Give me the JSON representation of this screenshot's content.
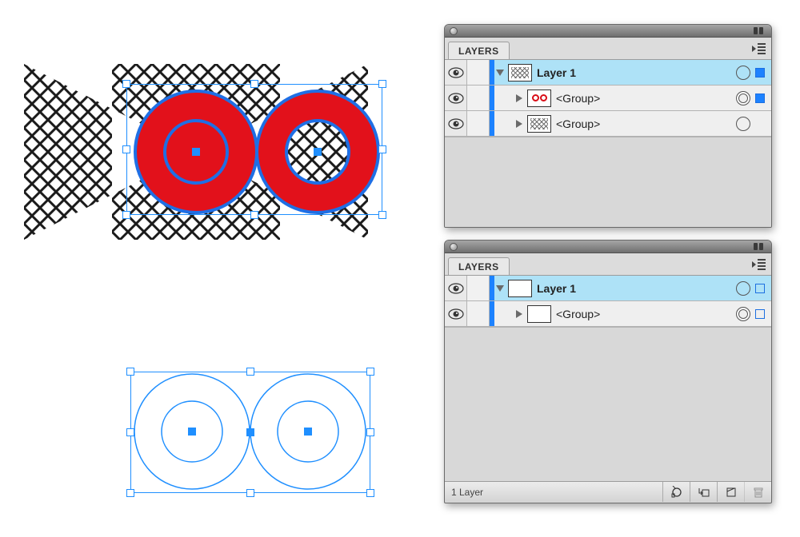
{
  "panel1": {
    "tab": "LAYERS",
    "rows": [
      {
        "name": "Layer 1",
        "bold": true,
        "selected": true,
        "thumb": "hatch",
        "expand": "down",
        "target": "single",
        "selSquare": "filled",
        "indent": 0
      },
      {
        "name": "<Group>",
        "bold": false,
        "selected": false,
        "thumb": "oo",
        "expand": "right",
        "target": "double",
        "selSquare": "filled",
        "indent": 1
      },
      {
        "name": "<Group>",
        "bold": false,
        "selected": false,
        "thumb": "hatch",
        "expand": "right",
        "target": "single",
        "selSquare": "none",
        "indent": 1
      }
    ]
  },
  "panel2": {
    "tab": "LAYERS",
    "status": "1 Layer",
    "rows": [
      {
        "name": "Layer 1",
        "bold": true,
        "selected": true,
        "thumb": "blank",
        "expand": "down",
        "target": "single",
        "selSquare": "outline",
        "indent": 0
      },
      {
        "name": "<Group>",
        "bold": false,
        "selected": false,
        "thumb": "blank",
        "expand": "right",
        "target": "double",
        "selSquare": "outline",
        "indent": 1
      }
    ]
  },
  "colors": {
    "selectionBlue": "#1f8fff",
    "ringRed": "#e2111b"
  }
}
